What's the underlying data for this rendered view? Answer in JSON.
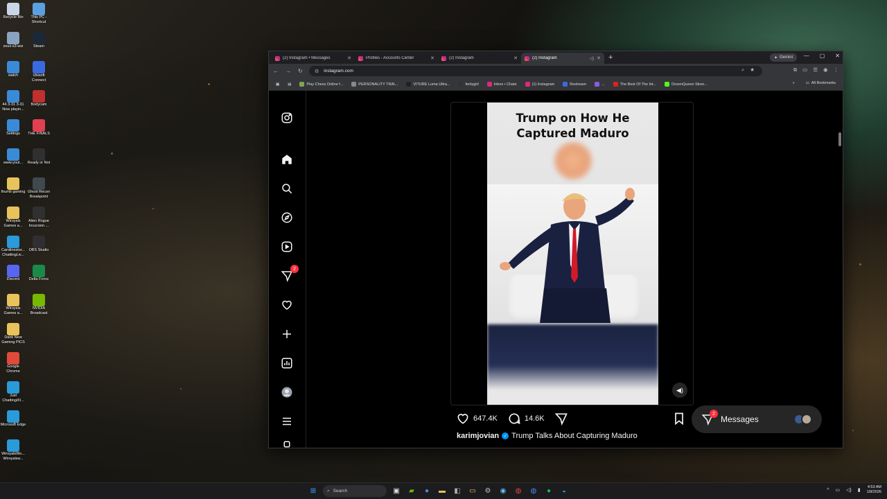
{
  "desktop": {
    "col1": [
      {
        "label": "Recycle Bin",
        "color": "#c8d6e6"
      },
      {
        "label": "zeus-s3-wiz",
        "color": "#8aa4c0"
      },
      {
        "label": "watch",
        "color": "#3b8ad8"
      },
      {
        "label": "44 3-31 3-31 Now playin...",
        "color": "#3b8ad8"
      },
      {
        "label": "Settings",
        "color": "#3b8ad8"
      },
      {
        "label": "www.yout...",
        "color": "#3b8ad8"
      },
      {
        "label": "thumb gaming",
        "color": "#e8c25a"
      },
      {
        "label": "Wiroyals Games a...",
        "color": "#e8c25a"
      },
      {
        "label": "Carolinestor... ChattingLiv...",
        "color": "#2a9ad8"
      },
      {
        "label": "Discord",
        "color": "#5865f2"
      },
      {
        "label": "Wiroyals Games a...",
        "color": "#e8c25a"
      },
      {
        "label": "Dank New Gaming PICS",
        "color": "#e8c25a"
      },
      {
        "label": "Google Chrome",
        "color": "#e04a3a"
      },
      {
        "label": "Just Chatting/III...",
        "color": "#2a9ad8"
      },
      {
        "label": "Microsoft Edge",
        "color": "#2a9ad8"
      },
      {
        "label": "WiroyalsWo... Wiroyalsw...",
        "color": "#2a9ad8"
      }
    ],
    "col2": [
      {
        "label": "This PC - Shortcut",
        "color": "#5aa0e0"
      },
      {
        "label": "Steam",
        "color": "#1b2838"
      },
      {
        "label": "Ubisoft Connect",
        "color": "#3a6ae0"
      },
      {
        "label": "Bodycam",
        "color": "#c03030"
      },
      {
        "label": "THE FINALS",
        "color": "#e04050"
      },
      {
        "label": "Ready or Not",
        "color": "#303030"
      },
      {
        "label": "Ghost Recon Breakpoint",
        "color": "#404850"
      },
      {
        "label": "Alien Rogue Incursion ...",
        "color": "#303030"
      },
      {
        "label": "OBS Studio",
        "color": "#302e31"
      },
      {
        "label": "Delta Force",
        "color": "#1a8a4a"
      },
      {
        "label": "NVIDIA Broadcast",
        "color": "#76b900"
      }
    ]
  },
  "browser": {
    "tabs": [
      {
        "label": "(2) Instagram • Messages",
        "active": false
      },
      {
        "label": "Profiles - Accounts Center",
        "active": false
      },
      {
        "label": "(2) Instagram",
        "active": false
      },
      {
        "label": "(2) Instagram",
        "active": true
      }
    ],
    "gemini_label": "Gemini",
    "url": "instagram.com",
    "bookmarks": [
      {
        "label": "Play Chess Online f...",
        "color": "#7fa650"
      },
      {
        "label": "PERSONALITY TRAI...",
        "color": "#888888"
      },
      {
        "label": "VITURE Luma Ultra...",
        "color": "#222222"
      },
      {
        "label": "fentygirl",
        "color": "#333333"
      },
      {
        "label": "Inbox • Chats",
        "color": "#dd2a7b"
      },
      {
        "label": "(1) Instagram",
        "color": "#dd2a7b"
      },
      {
        "label": "Restream",
        "color": "#3a6ae0"
      },
      {
        "label": "...",
        "color": "#8a5ae0"
      },
      {
        "label": "The Best Of The Int...",
        "color": "#e02020"
      },
      {
        "label": "DozenQueen Stree...",
        "color": "#53fc18"
      }
    ],
    "all_bookmarks": "All Bookmarks"
  },
  "post": {
    "video_title": "Trump on How He Captured Maduro",
    "likes": "647.4K",
    "comments": "14.6K",
    "username": "karimjovian",
    "caption": "Trump Talks About Capturing Maduro"
  },
  "messages": {
    "label": "Messages",
    "badge": "2"
  },
  "nav": {
    "notif_badge": "2"
  },
  "taskbar": {
    "search_placeholder": "Search",
    "time": "4:53 AM",
    "date": "1/8/2026"
  }
}
